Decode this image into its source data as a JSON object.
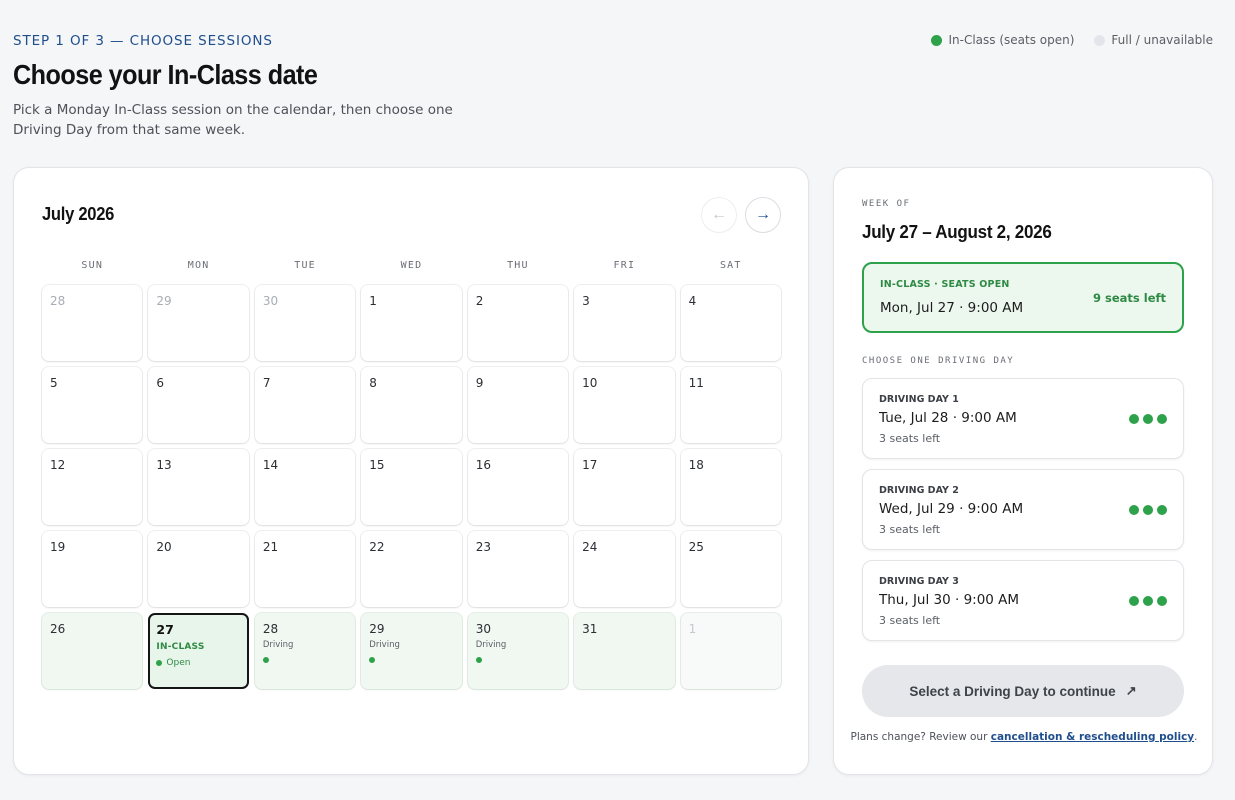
{
  "header": {
    "step": "STEP 1 OF 3 — CHOOSE SESSIONS",
    "title": "Choose your In-Class date",
    "subtitle": "Pick a Monday In-Class session on the calendar, then choose one Driving Day from that same week."
  },
  "legend": {
    "open_label": "In-Class (seats open)",
    "full_label": "Full / unavailable",
    "open_color": "#2ea24b",
    "full_color": "#e3e5ea"
  },
  "calendar": {
    "month_label": "July 2026",
    "prev_icon": "arrow-left-icon",
    "next_icon": "arrow-right-icon",
    "weekdays": [
      "SUN",
      "MON",
      "TUE",
      "WED",
      "THU",
      "FRI",
      "SAT"
    ],
    "days": [
      {
        "num": "28",
        "state": "muted"
      },
      {
        "num": "29",
        "state": "muted"
      },
      {
        "num": "30",
        "state": "muted"
      },
      {
        "num": "1"
      },
      {
        "num": "2"
      },
      {
        "num": "3"
      },
      {
        "num": "4"
      },
      {
        "num": "5"
      },
      {
        "num": "6"
      },
      {
        "num": "7"
      },
      {
        "num": "8"
      },
      {
        "num": "9"
      },
      {
        "num": "10"
      },
      {
        "num": "11"
      },
      {
        "num": "12"
      },
      {
        "num": "13"
      },
      {
        "num": "14"
      },
      {
        "num": "15"
      },
      {
        "num": "16"
      },
      {
        "num": "17"
      },
      {
        "num": "18"
      },
      {
        "num": "19"
      },
      {
        "num": "20"
      },
      {
        "num": "21"
      },
      {
        "num": "22"
      },
      {
        "num": "23"
      },
      {
        "num": "24"
      },
      {
        "num": "25"
      },
      {
        "num": "26",
        "state": "week"
      },
      {
        "num": "27",
        "state": "selected",
        "tag": "IN-CLASS",
        "status": "Open"
      },
      {
        "num": "28",
        "state": "week",
        "sub": "Driving"
      },
      {
        "num": "29",
        "state": "week",
        "sub": "Driving"
      },
      {
        "num": "30",
        "state": "week",
        "sub": "Driving"
      },
      {
        "num": "31",
        "state": "week"
      },
      {
        "num": "1",
        "state": "week-muted"
      }
    ]
  },
  "side": {
    "week_of_label": "WEEK OF",
    "week_range": "July 27 – August 2, 2026",
    "inclass": {
      "label": "IN-CLASS · SEATS OPEN",
      "datetime": "Mon, Jul 27 · 9:00 AM",
      "seats": "9 seats left"
    },
    "choose_label": "CHOOSE ONE DRIVING DAY",
    "driving_days": [
      {
        "label": "DRIVING DAY 1",
        "datetime": "Tue, Jul 28 · 9:00 AM",
        "seats": "3 seats left"
      },
      {
        "label": "DRIVING DAY 2",
        "datetime": "Wed, Jul 29 · 9:00 AM",
        "seats": "3 seats left"
      },
      {
        "label": "DRIVING DAY 3",
        "datetime": "Thu, Jul 30 · 9:00 AM",
        "seats": "3 seats left"
      }
    ],
    "cta": "Select a Driving Day to continue",
    "cta_icon": "arrow-up-right-icon",
    "policy_prefix": "Plans change? Review our",
    "policy_link": "cancellation & rescheduling policy",
    "policy_suffix": "."
  }
}
